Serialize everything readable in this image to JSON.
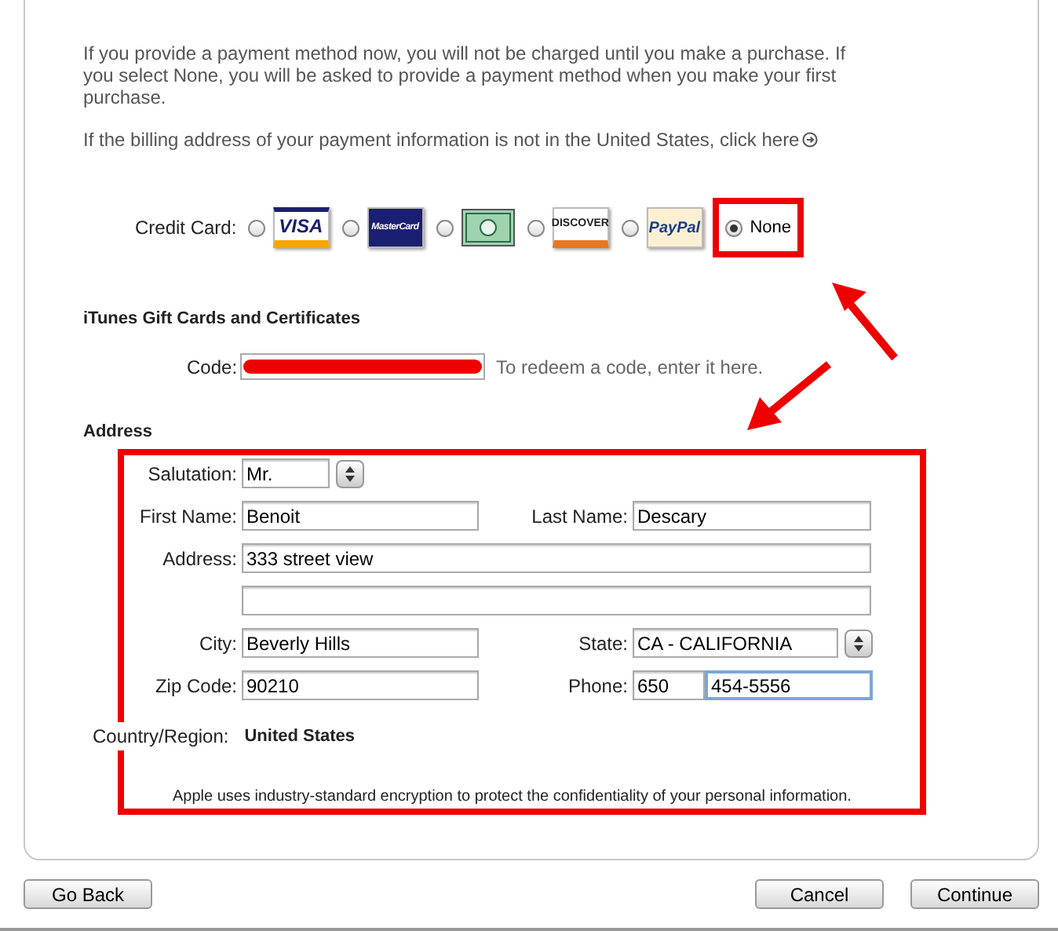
{
  "intro": [
    "If you provide a payment method now, you will not be charged until you make a purchase. If you select None, you will be asked to provide a payment method when you make your first purchase."
  ],
  "billing_link": "If the billing address of your payment information is not in the United States, click here",
  "payment": {
    "label": "Credit Card:",
    "options": [
      {
        "kind": "logo",
        "label": "VISA",
        "selected": false,
        "annotated": false
      },
      {
        "kind": "logo",
        "label": "MasterCard",
        "selected": false,
        "annotated": false
      },
      {
        "kind": "picture",
        "selected": false,
        "annotated": false
      },
      {
        "kind": "logo",
        "label": "DISCOVER",
        "selected": false,
        "annotated": false
      },
      {
        "kind": "logo",
        "label": "PayPal",
        "selected": false,
        "annotated": false
      },
      {
        "kind": "text",
        "label": "None",
        "selected": true,
        "annotated": true
      }
    ]
  },
  "gift": {
    "heading": "iTunes Gift Cards and Certificates",
    "label": "Code:",
    "redacted": true,
    "hint": "To redeem a code, enter it here."
  },
  "address": {
    "heading": "Address",
    "annotated": true,
    "salutation": {
      "label": "Salutation:",
      "value": "Mr."
    },
    "first_name": {
      "label": "First Name:",
      "value": "Benoit"
    },
    "last_name": {
      "label": "Last Name:",
      "value": "Descary"
    },
    "address": {
      "label": "Address:",
      "value": "333 street view"
    },
    "city": {
      "label": "City:",
      "value": "Beverly Hills"
    },
    "state": {
      "label": "State:",
      "value": "CA - CALIFORNIA"
    },
    "zip": {
      "label": "Zip Code:",
      "value": "90210"
    },
    "phone": {
      "label": "Phone:",
      "area": "650",
      "number": "454-5556",
      "focused": true
    },
    "country": {
      "label": "Country/Region:",
      "value": "United States"
    },
    "note": "Apple uses industry-standard encryption to protect the confidentiality of your personal information."
  },
  "buttons": {
    "back": "Go Back",
    "cancel": "Cancel",
    "continue": "Continue"
  }
}
